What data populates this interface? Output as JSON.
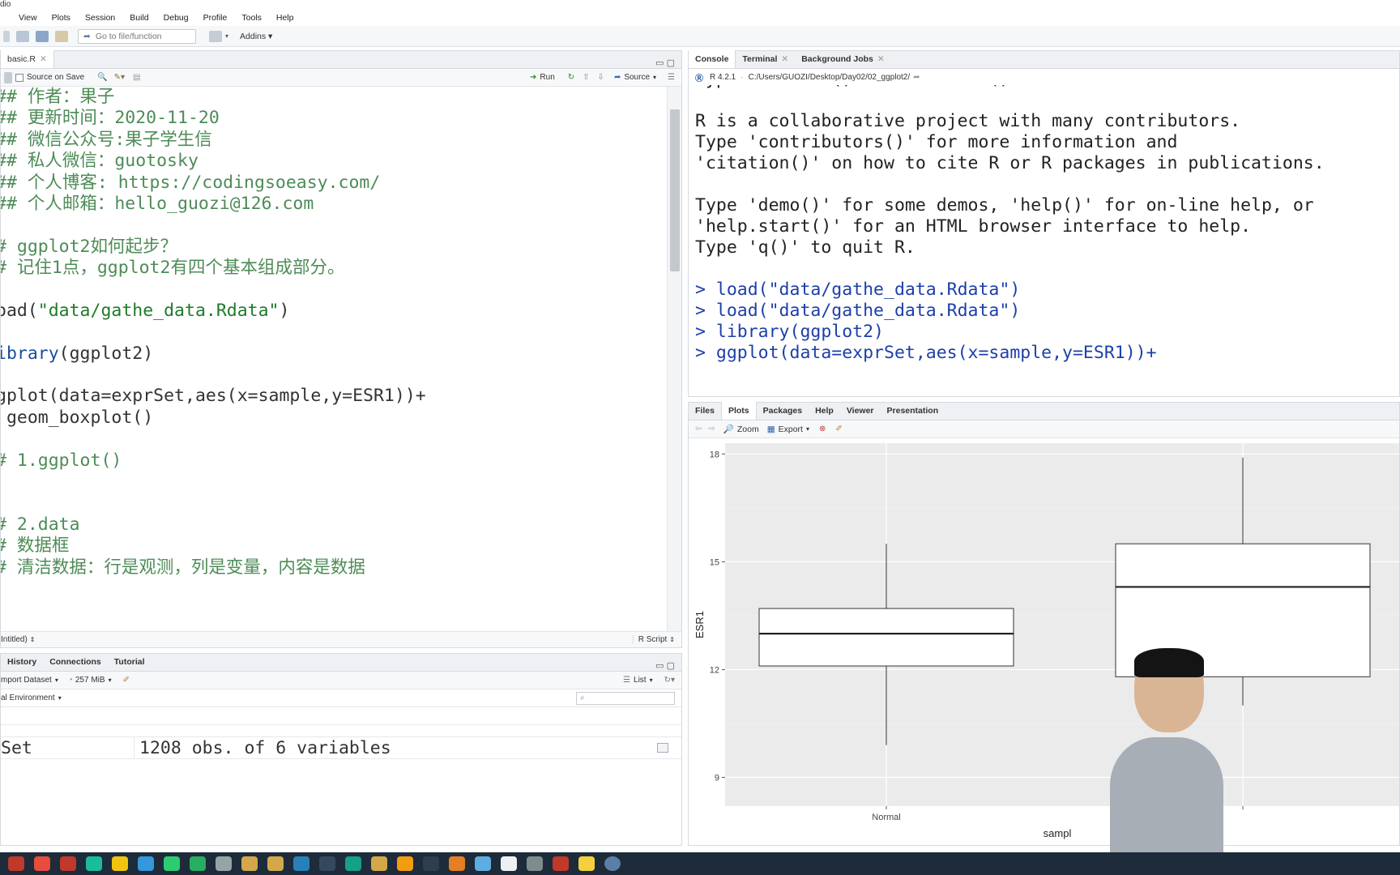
{
  "window": {
    "title_fragment": "dio"
  },
  "menu": [
    "View",
    "Plots",
    "Session",
    "Build",
    "Debug",
    "Profile",
    "Tools",
    "Help"
  ],
  "toolbar": {
    "goto_placeholder": "Go to file/function",
    "addins": "Addins"
  },
  "editor": {
    "tab_label": "basic.R",
    "source_on_save": "Source on Save",
    "run": "Run",
    "source": "Source",
    "status_left": "Intitled)",
    "status_right": "R Script",
    "lines": [
      {
        "cls": "cm",
        "text": "## 作者：果子"
      },
      {
        "cls": "cm",
        "text": "## 更新时间：2020-11-20"
      },
      {
        "cls": "cm",
        "text": "## 微信公众号:果子学生信"
      },
      {
        "cls": "cm",
        "text": "## 私人微信：guotosky"
      },
      {
        "cls": "cm",
        "text": "## 个人博客: https://codingsoeasy.com/"
      },
      {
        "cls": "cm",
        "text": "## 个人邮箱：hello_guozi@126.com"
      },
      {
        "cls": "",
        "text": ""
      },
      {
        "cls": "cm",
        "text": "# ggplot2如何起步？"
      },
      {
        "cls": "cm",
        "text": "# 记住1点，ggplot2有四个基本组成部分。"
      },
      {
        "cls": "",
        "text": ""
      },
      {
        "cls": "mix1",
        "text": "oad(\"data/gathe_data.Rdata\")"
      },
      {
        "cls": "",
        "text": ""
      },
      {
        "cls": "mix2",
        "text": "ibrary(ggplot2)"
      },
      {
        "cls": "",
        "text": ""
      },
      {
        "cls": "",
        "text": "gplot(data=exprSet,aes(x=sample,y=ESR1))+"
      },
      {
        "cls": "",
        "text": " geom_boxplot()"
      },
      {
        "cls": "",
        "text": ""
      },
      {
        "cls": "cm",
        "text": "# 1.ggplot()"
      },
      {
        "cls": "",
        "text": ""
      },
      {
        "cls": "",
        "text": ""
      },
      {
        "cls": "cm",
        "text": "# 2.data"
      },
      {
        "cls": "cm",
        "text": "# 数据框"
      },
      {
        "cls": "cm",
        "text": "# 清洁数据：行是观测，列是变量，内容是数据"
      }
    ]
  },
  "env": {
    "tabs": [
      "History",
      "Connections",
      "Tutorial"
    ],
    "import_dataset": "mport Dataset",
    "memory": "257 MiB",
    "list": "List",
    "scope": "al Environment",
    "row_name": "Set",
    "row_value": "1208 obs. of 6 variables"
  },
  "console": {
    "tabs": [
      "Console",
      "Terminal",
      "Background Jobs"
    ],
    "r_version": "R 4.2.1",
    "path": "C:/Users/GUOZI/Desktop/Day02/02_ggplot2/",
    "lines": [
      {
        "cls": "",
        "text": "Type 'license()' or 'licence()' for distribution details."
      },
      {
        "cls": "",
        "text": ""
      },
      {
        "cls": "",
        "text": "R is a collaborative project with many contributors."
      },
      {
        "cls": "",
        "text": "Type 'contributors()' for more information and"
      },
      {
        "cls": "",
        "text": "'citation()' on how to cite R or R packages in publications."
      },
      {
        "cls": "",
        "text": ""
      },
      {
        "cls": "",
        "text": "Type 'demo()' for some demos, 'help()' for on-line help, or"
      },
      {
        "cls": "",
        "text": "'help.start()' for an HTML browser interface to help."
      },
      {
        "cls": "",
        "text": "Type 'q()' to quit R."
      },
      {
        "cls": "",
        "text": ""
      },
      {
        "cls": "cmd",
        "text": "> load(\"data/gathe_data.Rdata\")"
      },
      {
        "cls": "cmd",
        "text": "> load(\"data/gathe_data.Rdata\")"
      },
      {
        "cls": "cmd",
        "text": "> library(ggplot2)"
      },
      {
        "cls": "cmd",
        "text": "> ggplot(data=exprSet,aes(x=sample,y=ESR1))+"
      }
    ]
  },
  "plots_pane": {
    "tabs": [
      "Files",
      "Plots",
      "Packages",
      "Help",
      "Viewer",
      "Presentation"
    ],
    "zoom": "Zoom",
    "export": "Export"
  },
  "chart_data": {
    "type": "boxplot",
    "ylabel": "ESR1",
    "xlabel": "sampl",
    "ylim": [
      8.2,
      18.3
    ],
    "yticks": [
      9,
      12,
      15,
      18
    ],
    "categories": [
      "Normal",
      ""
    ],
    "boxes": [
      {
        "name": "Normal",
        "whisker_low": 9.9,
        "q1": 12.1,
        "median": 13.0,
        "q3": 13.7,
        "whisker_high": 15.5
      },
      {
        "name": "",
        "whisker_low": 11.0,
        "q1": 11.8,
        "median": 14.3,
        "q3": 15.5,
        "whisker_high": 17.9
      }
    ],
    "panel_bg": "#ebebeb"
  },
  "colors": {
    "comment": "#4d8c57",
    "command": "#1c3faa",
    "taskbar": "#1d2b3a"
  }
}
